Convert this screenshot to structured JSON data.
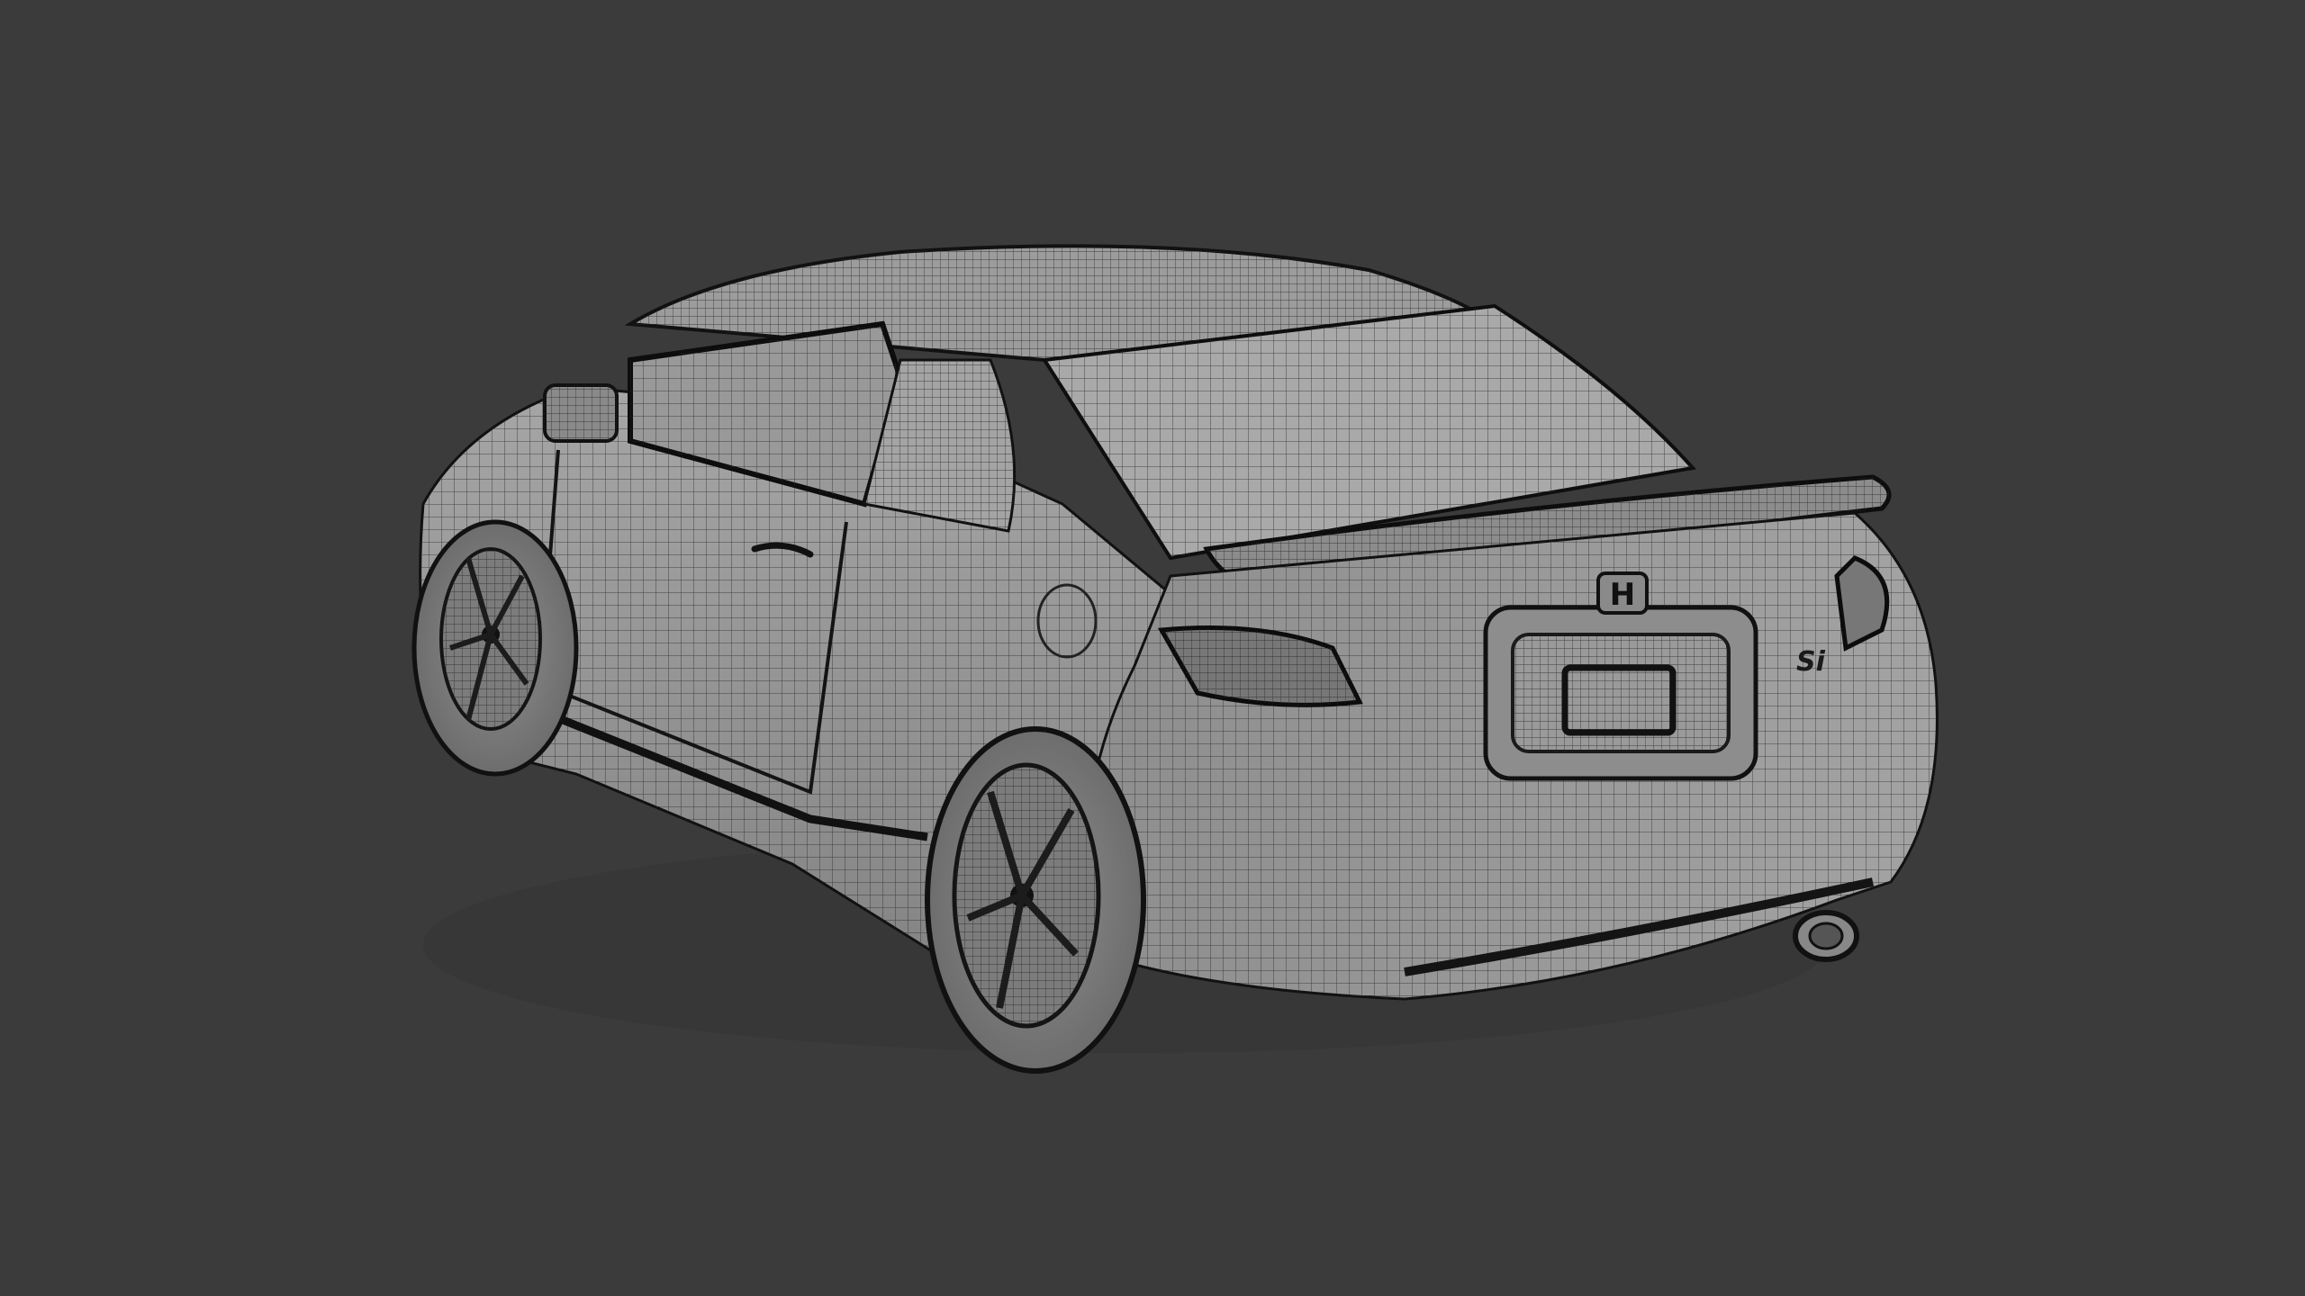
{
  "viewport": {
    "background_color": "#3b3b3b",
    "mesh_fill_color": "#8f8f8f",
    "mesh_light_color": "#a9a9a9",
    "wire_color": "#1e1e1e"
  },
  "car": {
    "emblem_logo": "H",
    "badge_text": "Si"
  }
}
